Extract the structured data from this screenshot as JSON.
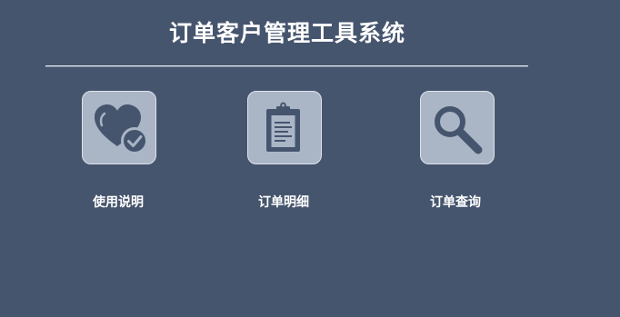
{
  "app": {
    "title": "订单客户管理工具系统"
  },
  "menu": {
    "items": [
      {
        "label": "使用说明",
        "icon": "heart-check-icon"
      },
      {
        "label": "订单明细",
        "icon": "clipboard-icon"
      },
      {
        "label": "订单查询",
        "icon": "search-icon"
      }
    ]
  },
  "colors": {
    "background": "#46556e",
    "tile": "#aab5c6",
    "icon": "#46556e",
    "text": "#ffffff"
  }
}
